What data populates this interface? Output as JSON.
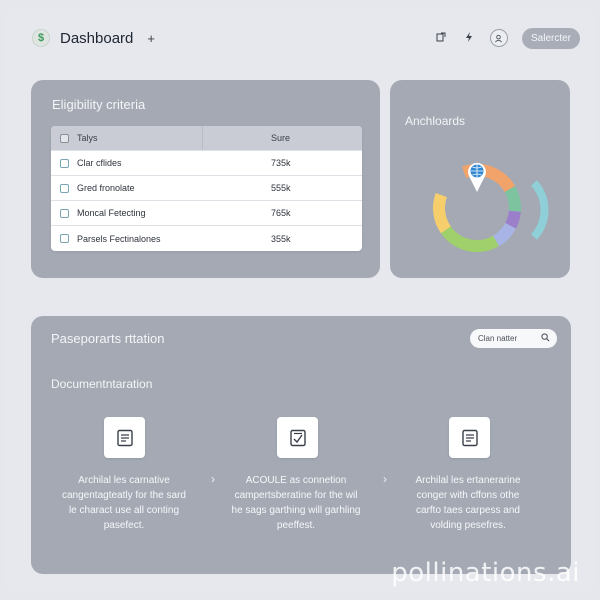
{
  "header": {
    "logo_glyph": "$",
    "title": "Dashboard",
    "add_glyph": "+",
    "user_button": "Salercter"
  },
  "eligibility": {
    "title": "Eligibility criteria",
    "columns": [
      "Talys",
      "Sure"
    ],
    "rows": [
      {
        "label": "Clar cflides",
        "value": "735k"
      },
      {
        "label": "Gred fronolate",
        "value": "555k"
      },
      {
        "label": "Moncal Fetecting",
        "value": "765k"
      },
      {
        "label": "Parsels Fectinalones",
        "value": "355k"
      }
    ]
  },
  "anchboards": {
    "title": "Anchloards",
    "segment_colors": [
      "#f2a36a",
      "#7ec3a0",
      "#9b7fcb",
      "#a9b4e6",
      "#9fd06b",
      "#f6cf6c",
      "#8fd0d8"
    ]
  },
  "passports": {
    "title": "Paseporarts rttation",
    "search_placeholder": "Clan natter",
    "subtitle": "Documentntaration",
    "steps": [
      {
        "icon": "document-list-icon",
        "text": "Archilal les carnative cangentagteatly for the sard le charact use all conting pasefect."
      },
      {
        "icon": "document-check-icon",
        "text": "ACOULE as connetion campertsberatine for the wil he sags garthing will garhling peeffest."
      },
      {
        "icon": "document-list-icon",
        "text": "Archilal les ertanerarine conger with cffons othe carfto taes carpess and volding pesefres."
      }
    ]
  },
  "watermark": "pollinations.ai"
}
